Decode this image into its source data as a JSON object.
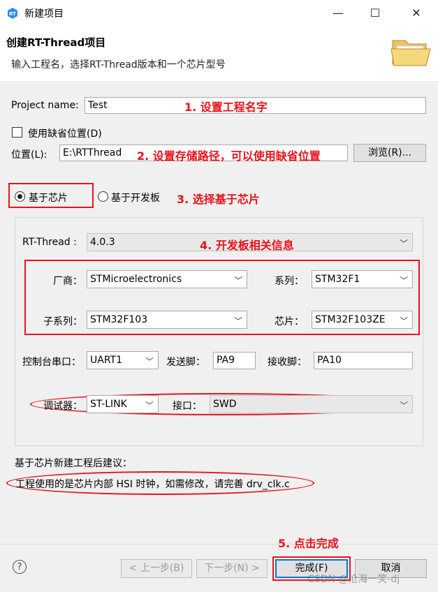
{
  "window": {
    "title": "新建项目",
    "minimize": "—",
    "maximize": "☐",
    "close": "✕"
  },
  "header": {
    "title": "创建RT-Thread项目",
    "subtitle": "输入工程名，选择RT-Thread版本和一个芯片型号"
  },
  "project": {
    "name_label": "Project name:",
    "name_value": "Test"
  },
  "location": {
    "default_checkbox_label": "使用缺省位置(D)",
    "default_checked": false,
    "path_label": "位置(L):",
    "path_value": "E:\\RTThread",
    "browse_button": "浏览(R)..."
  },
  "mode": {
    "chip_label": "基于芯片",
    "board_label": "基于开发板",
    "selected": "chip"
  },
  "chip_config": {
    "rtthread_label": "RT-Thread :",
    "rtthread_value": "4.0.3",
    "vendor_label": "厂商：",
    "vendor_value": "STMicroelectronics",
    "series_label": "系列：",
    "series_value": "STM32F1",
    "subseries_label": "子系列：",
    "subseries_value": "STM32F103",
    "chip_label": "芯片：",
    "chip_value": "STM32F103ZE",
    "console_label": "控制台串口：",
    "console_value": "UART1",
    "tx_label": "发送脚：",
    "tx_value": "PA9",
    "rx_label": "接收脚：",
    "rx_value": "PA10",
    "debugger_label": "调试器：",
    "debugger_value": "ST-LINK",
    "interface_label": "接口：",
    "interface_value": "SWD"
  },
  "advice": {
    "title": "基于芯片新建工程后建议：",
    "text": "工程使用的是芯片内部 HSI 时钟，如需修改，请完善 drv_clk.c"
  },
  "annotations": {
    "a1": "1. 设置工程名字",
    "a2": "2. 设置存储路径，可以使用缺省位置",
    "a3": "3. 选择基于芯片",
    "a4": "4. 开发板相关信息",
    "a5": "5. 点击完成"
  },
  "footer": {
    "help": "?",
    "back": "< 上一步(B)",
    "next": "下一步(N) >",
    "finish": "完成(F)",
    "cancel": "取消"
  },
  "watermark": "CSDN @沧海一笑-dj",
  "colors": {
    "annotation": "#e8121a",
    "finish_border": "#0078d7"
  }
}
